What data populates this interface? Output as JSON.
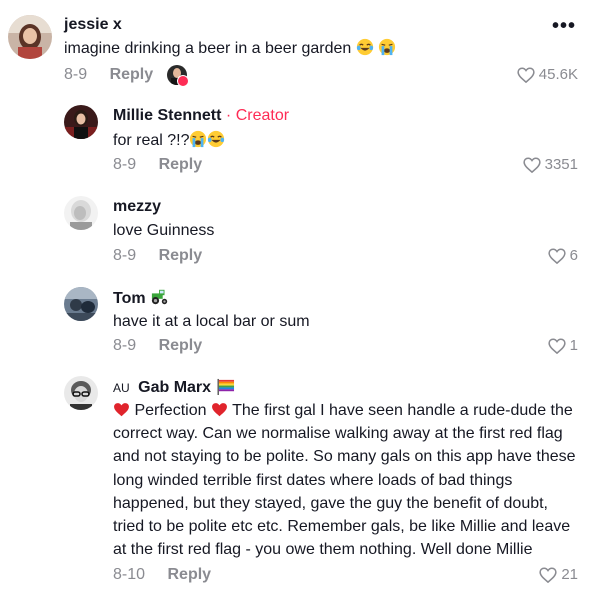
{
  "colors": {
    "accent": "#fe2c55",
    "muted": "#8a8b91",
    "text": "#161823"
  },
  "comments": [
    {
      "username": "jessie x",
      "text": "imagine drinking a beer in a beer garden",
      "emojis": [
        "laughing-crying-emoji",
        "loudly-crying-emoji"
      ],
      "date": "8-9",
      "reply": "Reply",
      "likes": "45.6K",
      "liked_by_creator": true,
      "more_menu": "•••"
    },
    {
      "username": "Millie Stennett",
      "creator_separator": "·",
      "creator_label": "Creator",
      "text": "for real ?!?",
      "emojis": [
        "loudly-crying-emoji",
        "laughing-crying-emoji"
      ],
      "date": "8-9",
      "reply": "Reply",
      "likes": "3351"
    },
    {
      "username": "mezzy",
      "text": "love Guinness",
      "date": "8-9",
      "reply": "Reply",
      "likes": "6"
    },
    {
      "username": "Tom",
      "username_emoji": "tractor-emoji",
      "text": "have it at a local bar or sum",
      "date": "8-9",
      "reply": "Reply",
      "likes": "1"
    },
    {
      "username_prefix": "AU",
      "username": "Gab Marx",
      "username_emoji": "rainbow-flag-emoji",
      "text_part1": "Perfection",
      "text_part2": "The first gal I have seen handle a rude-dude the correct way. Can we normalise walking away at the first red flag and not staying to be polite. So many gals on this app have these long winded terrible first dates where loads of bad things happened, but they stayed, gave the guy the benefit of doubt, tried to be polite etc etc. Remember gals, be like Millie and leave at the first red flag - you owe them nothing. Well done Millie",
      "date": "8-10",
      "reply": "Reply",
      "likes": "21"
    }
  ]
}
